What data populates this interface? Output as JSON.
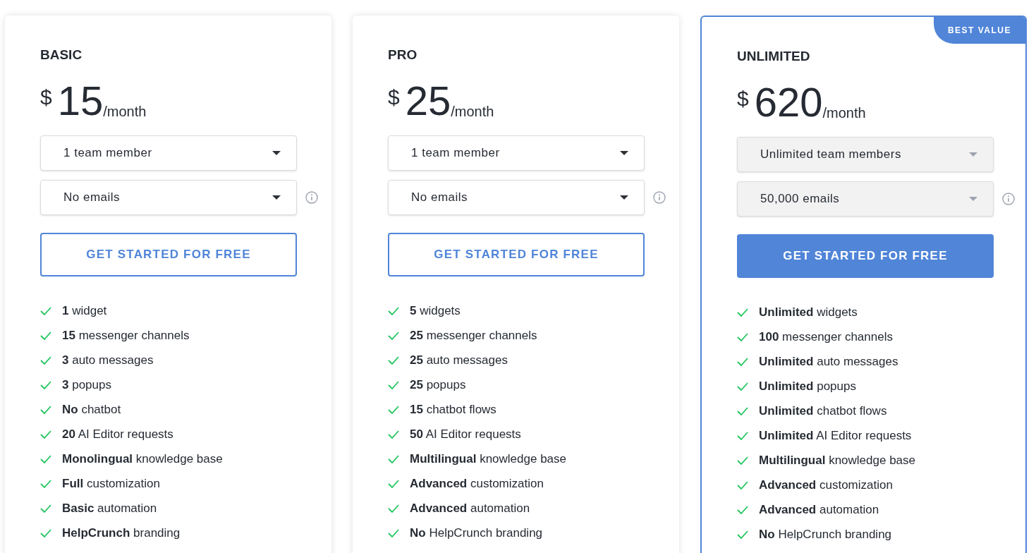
{
  "plans": [
    {
      "name": "BASIC",
      "currency": "$",
      "price": "15",
      "period": "/month",
      "featured": false,
      "selects": [
        {
          "value": "1 team member",
          "disabled": false,
          "info": false
        },
        {
          "value": "No emails",
          "disabled": false,
          "info": true
        }
      ],
      "button": "GET STARTED FOR FREE",
      "features": [
        "**1** widget",
        "**15** messenger channels",
        "**3** auto messages",
        "**3** popups",
        "**No** chatbot",
        "**20** AI Editor requests",
        "**Monolingual** knowledge base",
        "**Full** customization",
        "**Basic** automation",
        "**HelpCrunch** branding"
      ]
    },
    {
      "name": "PRO",
      "currency": "$",
      "price": "25",
      "period": "/month",
      "featured": false,
      "selects": [
        {
          "value": "1 team member",
          "disabled": false,
          "info": false
        },
        {
          "value": "No emails",
          "disabled": false,
          "info": true
        }
      ],
      "button": "GET STARTED FOR FREE",
      "features": [
        "**5** widgets",
        "**25** messenger channels",
        "**25** auto messages",
        "**25** popups",
        "**15** chatbot flows",
        "**50** AI Editor requests",
        "**Multilingual** knowledge base",
        "**Advanced** customization",
        "**Advanced** automation",
        "**No** HelpCrunch branding"
      ]
    },
    {
      "name": "UNLIMITED",
      "currency": "$",
      "price": "620",
      "period": "/month",
      "featured": true,
      "badge": "BEST VALUE",
      "selects": [
        {
          "value": "Unlimited team members",
          "disabled": true,
          "info": false
        },
        {
          "value": "50,000 emails",
          "disabled": true,
          "info": true
        }
      ],
      "button": "GET STARTED FOR FREE",
      "features": [
        "**Unlimited** widgets",
        "**100** messenger channels",
        "**Unlimited** auto messages",
        "**Unlimited** popups",
        "**Unlimited** chatbot flows",
        "**Unlimited** AI Editor requests",
        "**Multilingual** knowledge base",
        "**Advanced** customization",
        "**Advanced** automation",
        "**No** HelpCrunch branding"
      ]
    }
  ]
}
